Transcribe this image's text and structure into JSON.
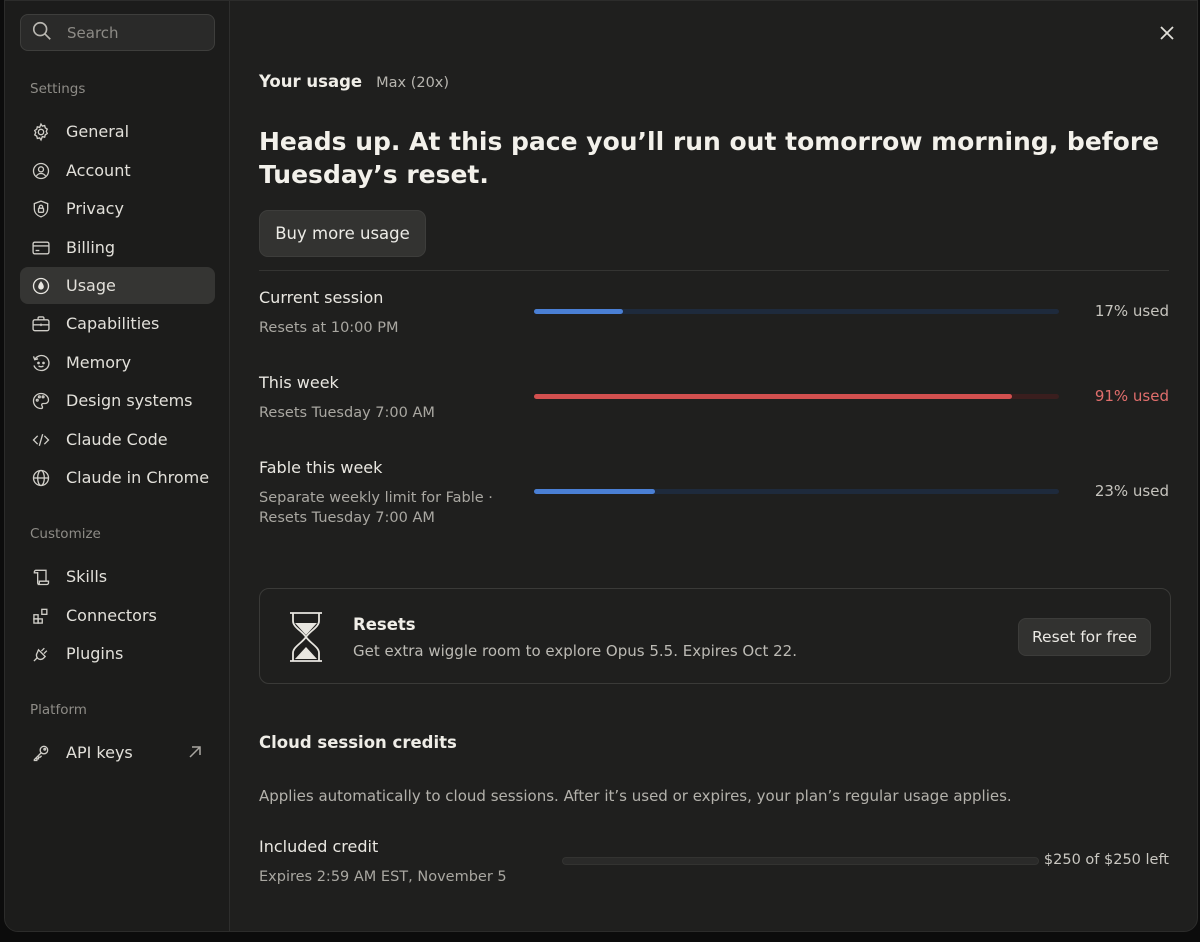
{
  "search": {
    "placeholder": "Search"
  },
  "sidebar": {
    "sections": [
      {
        "label": "Settings"
      },
      {
        "label": "Customize"
      },
      {
        "label": "Platform"
      }
    ],
    "settings_items": [
      {
        "label": "General",
        "icon": "gear-icon"
      },
      {
        "label": "Account",
        "icon": "user-circle-icon"
      },
      {
        "label": "Privacy",
        "icon": "shield-lock-icon"
      },
      {
        "label": "Billing",
        "icon": "credit-card-icon"
      },
      {
        "label": "Usage",
        "icon": "gauge-icon",
        "active": true
      },
      {
        "label": "Capabilities",
        "icon": "toolbox-icon"
      },
      {
        "label": "Memory",
        "icon": "memory-icon"
      },
      {
        "label": "Design systems",
        "icon": "palette-icon"
      },
      {
        "label": "Claude Code",
        "icon": "code-icon"
      },
      {
        "label": "Claude in Chrome",
        "icon": "globe-icon"
      }
    ],
    "customize_items": [
      {
        "label": "Skills",
        "icon": "scroll-icon"
      },
      {
        "label": "Connectors",
        "icon": "blocks-icon"
      },
      {
        "label": "Plugins",
        "icon": "plug-icon"
      }
    ],
    "platform_items": [
      {
        "label": "API keys",
        "icon": "key-icon",
        "external_icon": "arrow-up-right-icon"
      }
    ]
  },
  "main": {
    "heading": "Your usage",
    "plan": "Max (20x)",
    "headsup": "Heads up. At this pace you’ll run out tomorrow morning, before Tuesday’s reset.",
    "buy_button": "Buy more usage",
    "usage_rows": [
      {
        "title": "Current session",
        "subtitle": "Resets at 10:00 PM",
        "percent": 17,
        "percent_label": "17% used",
        "color": "#4a7fd4",
        "warning": false
      },
      {
        "title": "This week",
        "subtitle": "Resets Tuesday 7:00 AM",
        "percent": 91,
        "percent_label": "91% used",
        "color": "#d2504f",
        "warning": true
      },
      {
        "title": "Fable this week",
        "subtitle": "Separate weekly limit for Fable ·",
        "subtitle2": "Resets Tuesday 7:00 AM",
        "percent": 23,
        "percent_label": "23% used",
        "color": "#4a7fd4",
        "warning": false
      }
    ],
    "resets_card": {
      "title": "Resets",
      "description": "Get extra wiggle room to explore Opus 5.5. Expires Oct 22.",
      "button": "Reset for free",
      "icon": "hourglass-icon"
    },
    "cloud": {
      "title": "Cloud session credits",
      "description": "Applies automatically to cloud sessions. After it’s used or expires, your plan’s regular usage applies.",
      "credit_title": "Included credit",
      "credit_subtitle": "Expires 2:59 AM EST, November 5",
      "credit_left": "$250 of $250 left",
      "credit_used_fraction": 0
    }
  },
  "colors": {
    "accent_blue": "#4a7fd4",
    "warning_red": "#d2504f",
    "warning_text": "#e06e6c"
  }
}
